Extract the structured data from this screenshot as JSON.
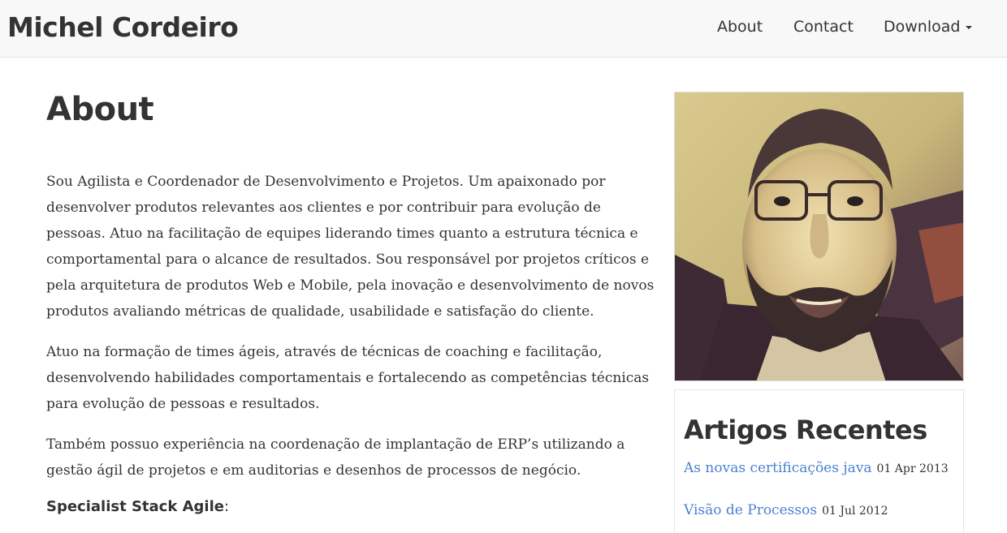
{
  "header": {
    "brand": "Michel Cordeiro",
    "nav": {
      "about": "About",
      "contact": "Contact",
      "download": "Download"
    }
  },
  "main": {
    "title": "About",
    "paragraphs": [
      "Sou Agilista e Coordenador de Desenvolvimento e Projetos. Um apaixonado por desenvolver produtos relevantes aos clientes e por contribuir para evolução de pessoas. Atuo na facilitação de equipes liderando times quanto a estrutura técnica e comportamental para o alcance de resultados. Sou responsável por projetos críticos e pela arquitetura de produtos Web e Mobile, pela inovação e desenvolvimento de novos produtos avaliando métricas de qualidade, usabilidade e satisfação do cliente.",
      "Atuo na formação de times ágeis, através de técnicas de coaching e facilitação, desenvolvendo habilidades comportamentais e fortalecendo as competências técnicas para evolução de pessoas e resultados.",
      "Também possuo experiência na coordenação de implantação de ERP’s utilizando a gestão ágil de projetos e em auditorias e desenhos de processos de negócio."
    ],
    "stack_label": "Specialist Stack Agile",
    "stack_colon": ":"
  },
  "sidebar": {
    "photo_icon": "profile-photo",
    "recent_title": "Artigos Recentes",
    "articles": [
      {
        "title": "As novas certificações java",
        "date": "01 Apr 2013"
      },
      {
        "title": "Visão de Processos",
        "date": "01 Jul 2012"
      }
    ]
  },
  "colors": {
    "link": "#4a7fd0",
    "text": "#333333",
    "navbar_bg": "#f8f8f8"
  }
}
